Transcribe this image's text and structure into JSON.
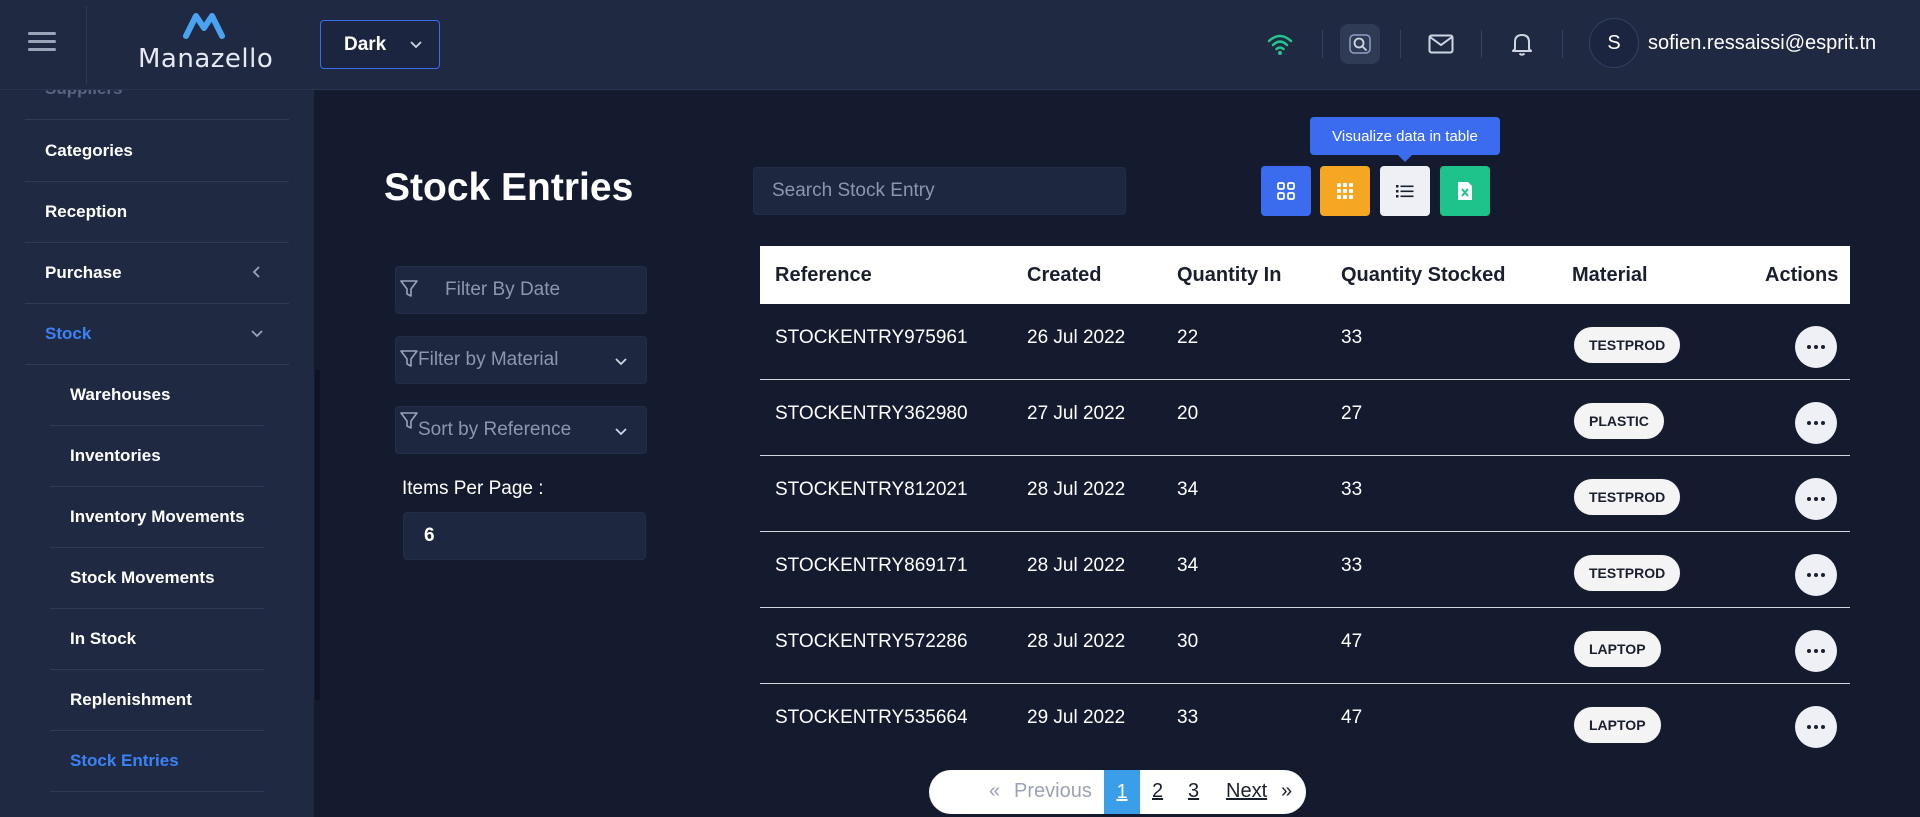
{
  "header": {
    "logo_text": "Manazello",
    "theme_value": "Dark",
    "user_initial": "S",
    "user_email": "sofien.ressaissi@esprit.tn",
    "accent_color": "#3b6cf0",
    "wifi_color": "#22c58b"
  },
  "sidebar": {
    "items": [
      {
        "label": "Suppliers"
      },
      {
        "label": "Categories"
      },
      {
        "label": "Reception"
      },
      {
        "label": "Purchase"
      },
      {
        "label": "Stock"
      },
      {
        "label": "Warehouses"
      },
      {
        "label": "Inventories"
      },
      {
        "label": "Inventory Movements"
      },
      {
        "label": "Stock Movements"
      },
      {
        "label": "In Stock"
      },
      {
        "label": "Replenishment"
      },
      {
        "label": "Stock Entries"
      }
    ]
  },
  "main": {
    "title": "Stock Entries",
    "search_placeholder": "Search Stock Entry",
    "tooltip": "Visualize data in table",
    "view_buttons": [
      {
        "icon": "grid-2x2-icon",
        "color": "#3b6cf0"
      },
      {
        "icon": "grid-3x3-icon",
        "color": "#f5a623"
      },
      {
        "icon": "list-icon",
        "color": "#eef0f5"
      },
      {
        "icon": "excel-icon",
        "color": "#1ec38b"
      }
    ],
    "filters": {
      "date_placeholder": "Filter By Date",
      "material_value": "Filter by Material",
      "sort_value": "Sort by Reference"
    },
    "items_per_page_label": "Items Per Page :",
    "items_per_page_value": "6"
  },
  "table": {
    "headers": [
      "Reference",
      "Created",
      "Quantity In",
      "Quantity Stocked",
      "Material",
      "Actions"
    ],
    "rows": [
      {
        "reference": "STOCKENTRY975961",
        "created": "26 Jul 2022",
        "qty_in": "22",
        "qty_stocked": "33",
        "material": "TESTPROD"
      },
      {
        "reference": "STOCKENTRY362980",
        "created": "27 Jul 2022",
        "qty_in": "20",
        "qty_stocked": "27",
        "material": "PLASTIC"
      },
      {
        "reference": "STOCKENTRY812021",
        "created": "28 Jul 2022",
        "qty_in": "34",
        "qty_stocked": "33",
        "material": "TESTPROD"
      },
      {
        "reference": "STOCKENTRY869171",
        "created": "28 Jul 2022",
        "qty_in": "34",
        "qty_stocked": "33",
        "material": "TESTPROD"
      },
      {
        "reference": "STOCKENTRY572286",
        "created": "28 Jul 2022",
        "qty_in": "30",
        "qty_stocked": "47",
        "material": "LAPTOP"
      },
      {
        "reference": "STOCKENTRY535664",
        "created": "29 Jul 2022",
        "qty_in": "33",
        "qty_stocked": "47",
        "material": "LAPTOP"
      }
    ]
  },
  "pagination": {
    "prev_arrow": "«",
    "previous": "Previous",
    "pages": [
      "1",
      "2",
      "3"
    ],
    "current": "1",
    "next": "Next",
    "next_arrow": "»"
  }
}
